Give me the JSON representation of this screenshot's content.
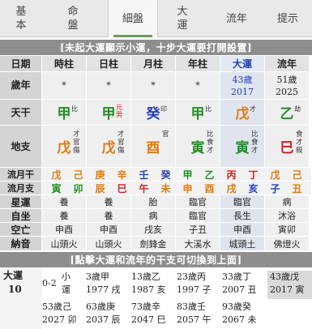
{
  "tabs": [
    {
      "line1": "基",
      "line2": "本"
    },
    {
      "line1": "命",
      "line2": "盤"
    },
    {
      "label": "細盤"
    },
    {
      "line1": "大",
      "line2": "運"
    },
    {
      "label": "流年"
    },
    {
      "label": "提示"
    }
  ],
  "notice1": "[未起大運顯示小運，十步大運要打開設置]",
  "notice2": "[點擊大運和流年的干支可切換到上面]",
  "headers": {
    "label": "日期",
    "cols": [
      "時柱",
      "日柱",
      "月柱",
      "年柱",
      "大運",
      "流年"
    ]
  },
  "age_row": {
    "label": "歲年",
    "cols": [
      "*",
      "*",
      "*",
      "*"
    ],
    "dayun_age": "43歲",
    "dayun_year": "2017",
    "liunian_age": "51歲",
    "liunian_year": "2025"
  },
  "tiangan": {
    "label": "天干",
    "chars": [
      "甲",
      "甲",
      "癸",
      "甲",
      "戊",
      "乙"
    ],
    "shishen": [
      "比",
      "元男",
      "印",
      "比",
      "才",
      "劫"
    ],
    "colors": [
      "#1f8f23",
      "#1f8f23",
      "#2340b8",
      "#1f8f23",
      "#e07a10",
      "#1f8f23"
    ]
  },
  "dizhi": {
    "label": "地支",
    "chars": [
      "戊",
      "戊",
      "酉",
      "寅",
      "寅",
      "巳"
    ],
    "canggan": [
      [
        "才",
        "官",
        "傷"
      ],
      [
        "才",
        "官",
        "傷"
      ],
      [
        "官"
      ],
      [
        "比",
        "食",
        "才"
      ],
      [
        "比",
        "食",
        "才"
      ],
      [
        "食",
        "才",
        "殺"
      ]
    ],
    "colors": [
      "#e07a10",
      "#e07a10",
      "#e07a10",
      "#1f8f23",
      "#1f8f23",
      "#d02020"
    ]
  },
  "liuyue_gan": {
    "label": "流月干",
    "chars": [
      "戊",
      "己",
      "庚",
      "辛",
      "壬",
      "癸",
      "甲",
      "乙",
      "丙",
      "丁",
      "戊",
      "己"
    ],
    "colors": [
      "#e07a10",
      "#e07a10",
      "#e07a10",
      "#e07a10",
      "#2340b8",
      "#2340b8",
      "#1f8f23",
      "#1f8f23",
      "#d02020",
      "#d02020",
      "#e07a10",
      "#e07a10"
    ]
  },
  "liuyue_zhi": {
    "label": "流月支",
    "chars": [
      "寅",
      "卯",
      "辰",
      "巳",
      "午",
      "未",
      "申",
      "酉",
      "戌",
      "亥",
      "子",
      "丑"
    ],
    "colors": [
      "#1f8f23",
      "#1f8f23",
      "#e07a10",
      "#d02020",
      "#d02020",
      "#e07a10",
      "#e07a10",
      "#e07a10",
      "#e07a10",
      "#2340b8",
      "#2340b8",
      "#e07a10"
    ]
  },
  "xingyun": {
    "label": "星運",
    "cols": [
      "養",
      "養",
      "胎",
      "臨官",
      "臨官",
      "病"
    ]
  },
  "zizuo": {
    "label": "自坐",
    "cols": [
      "養",
      "養",
      "病",
      "臨官",
      "長生",
      "沐浴"
    ]
  },
  "kongwang": {
    "label": "空亡",
    "cols": [
      "申酉",
      "申酉",
      "戌亥",
      "子丑",
      "申酉",
      "寅卯"
    ]
  },
  "nayin": {
    "label": "納音",
    "cols": [
      "山頭火",
      "山頭火",
      "劍鋒金",
      "大溪水",
      "城頭土",
      "佛燈火"
    ]
  },
  "dayun": {
    "label": "大運",
    "start_age": "10",
    "xiaoyun_age": "0-2",
    "xiaoyun_label": "小運",
    "items": [
      {
        "age": "3歲",
        "gz1": "甲",
        "year": "1977",
        "gz2": "戌"
      },
      {
        "age": "13歲",
        "gz1": "乙",
        "year": "1987",
        "gz2": "亥"
      },
      {
        "age": "23歲",
        "gz1": "丙",
        "year": "1997",
        "gz2": "子"
      },
      {
        "age": "33歲",
        "gz1": "丁",
        "year": "2007",
        "gz2": "丑"
      },
      {
        "age": "53歲",
        "gz1": "己",
        "year": "2027",
        "gz2": "卯"
      },
      {
        "age": "63歲",
        "gz1": "庚",
        "year": "2037",
        "gz2": "辰"
      },
      {
        "age": "73歲",
        "gz1": "辛",
        "year": "2047",
        "gz2": "巳"
      },
      {
        "age": "83歲",
        "gz1": "壬",
        "year": "2057",
        "gz2": "午"
      },
      {
        "age": "93歲",
        "gz1": "癸",
        "year": "2067",
        "gz2": "未"
      }
    ],
    "current": {
      "age": "43歲",
      "gz1": "戊",
      "year": "2017",
      "gz2": "寅"
    }
  }
}
